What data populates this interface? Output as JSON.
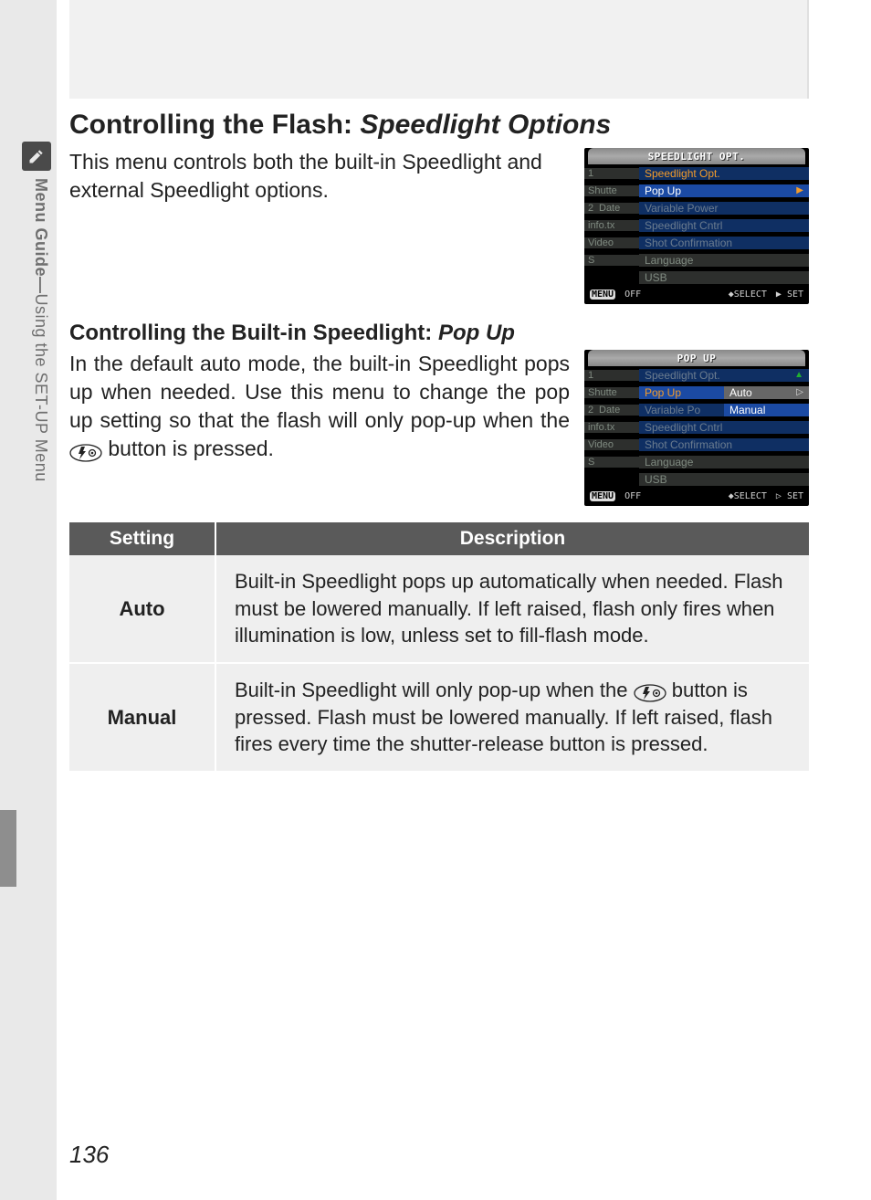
{
  "sideTab": {
    "prefix": "Menu Guide—",
    "suffix": "Using the SET-UP Menu"
  },
  "pageNumber": "136",
  "section1": {
    "heading_plain": "Controlling the Flash: ",
    "heading_italic": "Speedlight Options",
    "body": "This menu controls both the built-in Speedlight and external Speedlight options."
  },
  "section2": {
    "heading_plain": "Controlling the Built-in Speedlight: ",
    "heading_italic": "Pop Up",
    "body_pre": "In the default auto mode, the built-in Speedlight pops up when needed. Use this menu to change the pop up setting so that the flash will only pop-up when the ",
    "body_post": " button is pressed."
  },
  "lcd1": {
    "title": "SPEEDLIGHT OPT.",
    "rows": {
      "r0": "Speedlight Opt.",
      "r1l": "Shutte",
      "r1r": "Pop Up",
      "r2l": "Date",
      "r2r": "Variable Power",
      "r3l": "info.tx",
      "r3r": "Speedlight Cntrl",
      "r4l": "Video",
      "r4r": "Shot Confirmation",
      "r5": "Language",
      "r6": "USB"
    },
    "side": {
      "n1": "1",
      "n2": "2",
      "nS": "S"
    },
    "footer": {
      "menu": "MENU",
      "off": "OFF",
      "select": "SELECT",
      "set": "SET"
    }
  },
  "lcd2": {
    "title": "POP UP",
    "rows": {
      "r0": "Speedlight Opt.",
      "r1l": "Shutte",
      "r1m": "Pop Up",
      "r1r": "Auto",
      "r2l": "Date",
      "r2m": "Variable Po",
      "r2r": "Manual",
      "r3l": "info.tx",
      "r3m": "Speedlight Cntrl",
      "r4l": "Video",
      "r4m": "Shot Confirmation",
      "r5": "Language",
      "r6": "USB"
    },
    "side": {
      "n1": "1",
      "n2": "2",
      "nS": "S"
    },
    "footer": {
      "menu": "MENU",
      "off": "OFF",
      "select": "SELECT",
      "set": "SET"
    }
  },
  "table": {
    "head": {
      "setting": "Setting",
      "desc": "Description"
    },
    "rows": {
      "auto": {
        "label": "Auto",
        "desc": "Built-in Speedlight pops up automatically when needed. Flash must be lowered manually. If left raised, flash only fires when illumination is low, unless set to fill-flash mode."
      },
      "manual": {
        "label": "Manual",
        "desc_pre": "Built-in Speedlight will only pop-up when the ",
        "desc_post": " button is pressed. Flash must be lowered manually. If left raised, flash fires every time the shutter-release button is pressed."
      }
    }
  }
}
